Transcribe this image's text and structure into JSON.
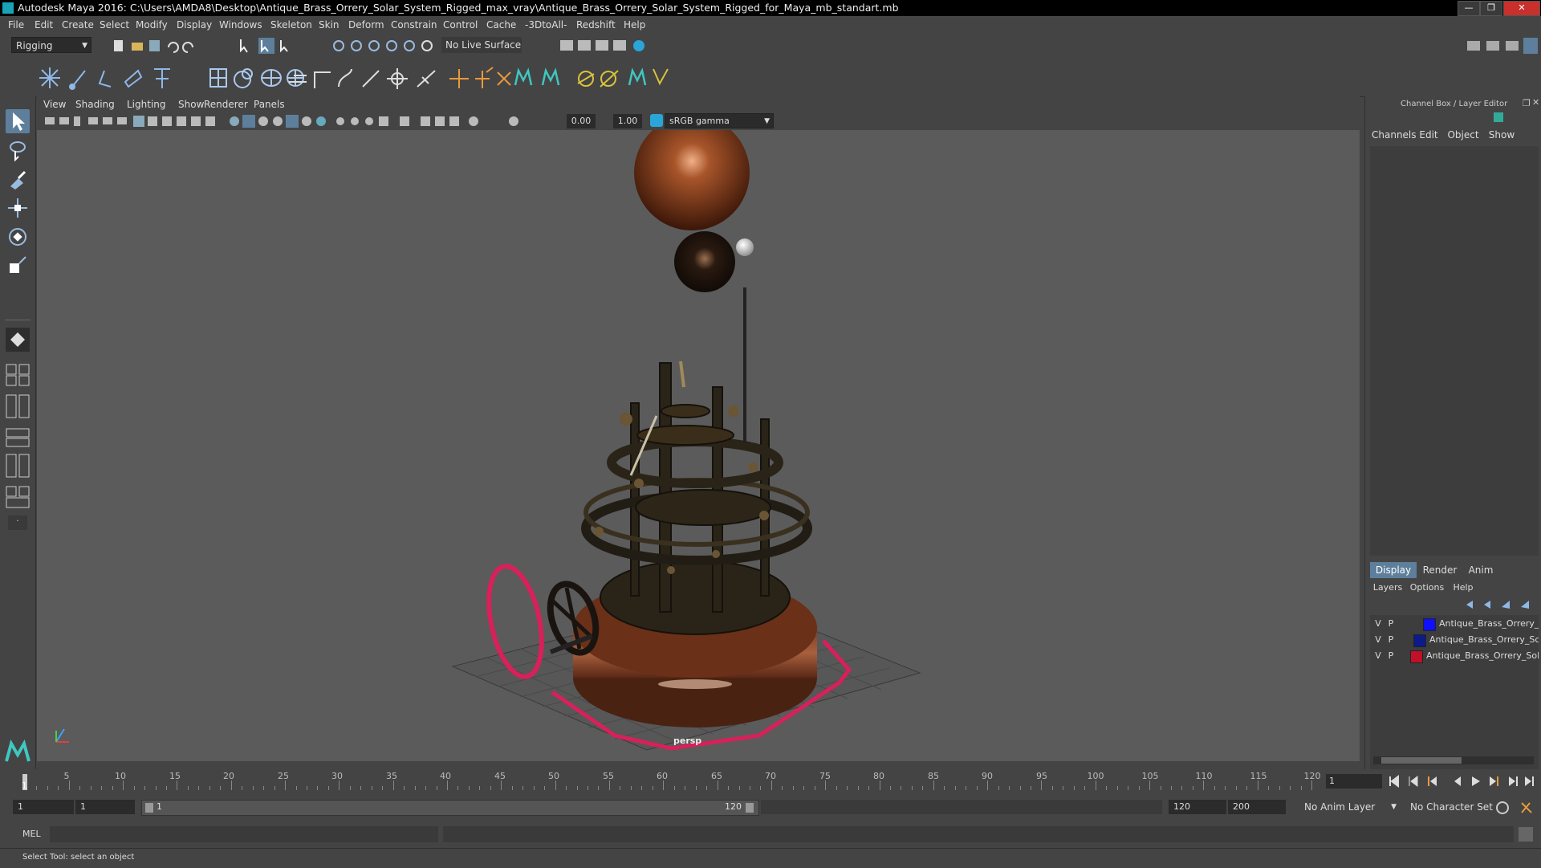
{
  "window": {
    "title": "Autodesk Maya 2016: C:\\Users\\AMDA8\\Desktop\\Antique_Brass_Orrery_Solar_System_Rigged_max_vray\\Antique_Brass_Orrery_Solar_System_Rigged_for_Maya_mb_standart.mb"
  },
  "menu": [
    "File",
    "Edit",
    "Create",
    "Select",
    "Modify",
    "Display",
    "Windows",
    "Skeleton",
    "Skin",
    "Deform",
    "Constrain",
    "Control",
    "Cache",
    "-3DtoAll-",
    "Redshift",
    "Help"
  ],
  "statusline": {
    "mode": "Rigging",
    "live_surface": "No Live Surface"
  },
  "panel": {
    "menu": [
      "View",
      "Shading",
      "Lighting",
      "Show",
      "Renderer",
      "Panels"
    ],
    "exposure": "0.00",
    "gamma": "1.00",
    "colorspace": "sRGB gamma",
    "camera_label": "persp"
  },
  "rightpanel": {
    "header": "Channel Box / Layer Editor",
    "channel_tabs": [
      "Channels",
      "Edit",
      "Object",
      "Show"
    ],
    "layer_tabs": [
      "Display",
      "Render",
      "Anim"
    ],
    "layer_menu": [
      "Layers",
      "Options",
      "Help"
    ],
    "layers": [
      {
        "v": "V",
        "p": "P",
        "color": "#1010ff",
        "name": "Antique_Brass_Orrery_"
      },
      {
        "v": "V",
        "p": "P",
        "color": "#0c1a8a",
        "name": "Antique_Brass_Orrery_Sc"
      },
      {
        "v": "V",
        "p": "P",
        "color": "#c0102a",
        "name": "Antique_Brass_Orrery_Sol"
      }
    ]
  },
  "timeline": {
    "ticks": [
      "5",
      "10",
      "15",
      "20",
      "25",
      "30",
      "35",
      "40",
      "45",
      "50",
      "55",
      "60",
      "65",
      "70",
      "75",
      "80",
      "85",
      "90",
      "95",
      "100",
      "105",
      "110",
      "115",
      "120"
    ],
    "current_frame_marker": "1",
    "current_frame_field": "1"
  },
  "range": {
    "start": "1",
    "playback_start": "1",
    "slider_start": "1",
    "slider_end": "120",
    "playback_end": "120",
    "end": "200",
    "anim_layer": "No Anim Layer",
    "character_set": "No Character Set"
  },
  "cmdline": {
    "language": "MEL"
  },
  "helpline": {
    "text": "Select Tool: select an object"
  },
  "colors": {
    "accent": "#5d7f9c",
    "wireframe_ctrl": "#d8205a",
    "viewport_bg": "#5b5b5b"
  }
}
